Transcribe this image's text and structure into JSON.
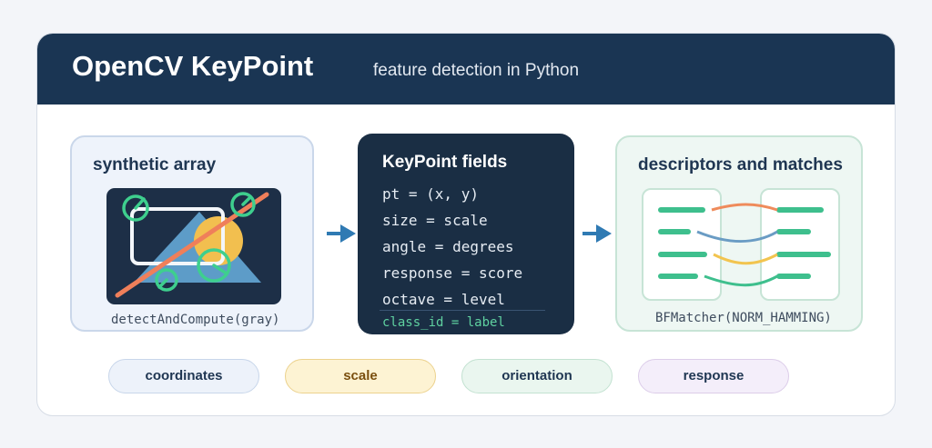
{
  "header": {
    "title": "OpenCV KeyPoint",
    "subtitle": "feature detection in Python"
  },
  "panels": {
    "synthetic": {
      "title": "synthetic array",
      "caption": "detectAndCompute(gray)"
    },
    "fields": {
      "title": "KeyPoint fields",
      "lines": [
        "pt = (x, y)",
        "size = scale",
        "angle = degrees",
        "response = score",
        "octave = level"
      ],
      "footer": "class_id = label"
    },
    "matches": {
      "title": "descriptors and matches",
      "caption": "BFMatcher(NORM_HAMMING)"
    }
  },
  "tags": [
    "coordinates",
    "scale",
    "orientation",
    "response"
  ],
  "colors": {
    "header": "#1a3553",
    "arrow": "#2f7ab3",
    "keypoint": "#3ecf8e",
    "edge_line": "#ef7f5a",
    "circle_fill": "#f2bf4f",
    "triangle": "#5d9cc8",
    "match_orange": "#ef8b5b",
    "match_blue": "#6a9cc4",
    "match_yellow": "#f2c44f",
    "match_green": "#3ebf8d"
  }
}
